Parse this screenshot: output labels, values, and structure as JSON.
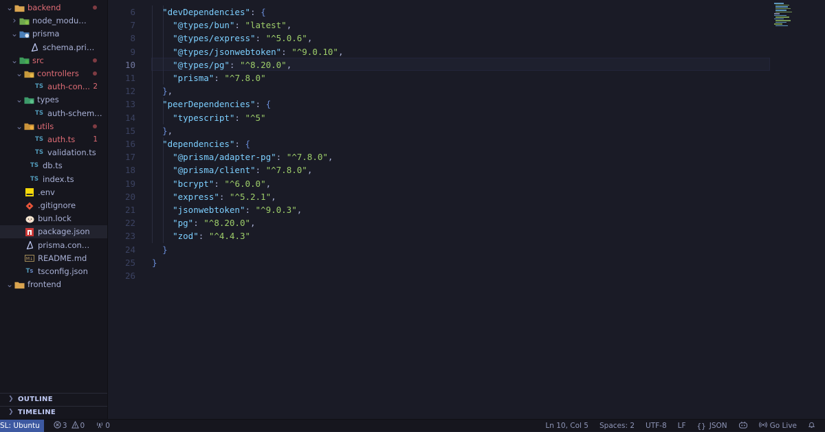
{
  "explorer": {
    "items": [
      {
        "label": "backend",
        "type": "folder",
        "open": true,
        "error": true,
        "dot": true
      },
      {
        "label": "node_modules",
        "type": "folder-node",
        "open": false
      },
      {
        "label": "prisma",
        "type": "folder-prisma",
        "open": true
      },
      {
        "label": "schema.prisma",
        "type": "file-prisma"
      },
      {
        "label": "src",
        "type": "folder-src",
        "open": true,
        "error": true,
        "dot": true
      },
      {
        "label": "controllers",
        "type": "folder-controllers",
        "open": true,
        "error": true,
        "dot": true
      },
      {
        "label": "auth-con...",
        "type": "file-ts",
        "error": true,
        "count": "2"
      },
      {
        "label": "types",
        "type": "folder-types",
        "open": true
      },
      {
        "label": "auth-schema.ts",
        "type": "file-ts"
      },
      {
        "label": "utils",
        "type": "folder-utils",
        "open": true,
        "error": true,
        "dot": true
      },
      {
        "label": "auth.ts",
        "type": "file-ts",
        "error": true,
        "count": "1"
      },
      {
        "label": "validation.ts",
        "type": "file-ts"
      },
      {
        "label": "db.ts",
        "type": "file-ts"
      },
      {
        "label": "index.ts",
        "type": "file-ts"
      },
      {
        "label": ".env",
        "type": "file-env"
      },
      {
        "label": ".gitignore",
        "type": "file-git"
      },
      {
        "label": "bun.lock",
        "type": "file-bun"
      },
      {
        "label": "package.json",
        "type": "file-npm",
        "selected": true
      },
      {
        "label": "prisma.config.ts",
        "type": "file-prisma"
      },
      {
        "label": "README.md",
        "type": "file-md"
      },
      {
        "label": "tsconfig.json",
        "type": "file-tsconfig"
      },
      {
        "label": "frontend",
        "type": "folder-root",
        "open": true
      }
    ],
    "outline_label": "OUTLINE",
    "timeline_label": "TIMELINE"
  },
  "editor": {
    "active_line": 10,
    "lines": [
      {
        "n": "6",
        "tokens": [
          [
            "p",
            "  "
          ],
          [
            "k",
            "\"devDependencies\""
          ],
          [
            "p",
            ": "
          ],
          [
            "b",
            "{"
          ]
        ]
      },
      {
        "n": "7",
        "tokens": [
          [
            "p",
            "    "
          ],
          [
            "k",
            "\"@types/bun\""
          ],
          [
            "p",
            ": "
          ],
          [
            "s",
            "\"latest\""
          ],
          [
            "p",
            ","
          ]
        ]
      },
      {
        "n": "8",
        "tokens": [
          [
            "p",
            "    "
          ],
          [
            "k",
            "\"@types/express\""
          ],
          [
            "p",
            ": "
          ],
          [
            "s",
            "\"^5.0.6\""
          ],
          [
            "p",
            ","
          ]
        ]
      },
      {
        "n": "9",
        "tokens": [
          [
            "p",
            "    "
          ],
          [
            "k",
            "\"@types/jsonwebtoken\""
          ],
          [
            "p",
            ": "
          ],
          [
            "s",
            "\"^9.0.10\""
          ],
          [
            "p",
            ","
          ]
        ]
      },
      {
        "n": "10",
        "tokens": [
          [
            "p",
            "    "
          ],
          [
            "k",
            "\"@types/pg\""
          ],
          [
            "p",
            ": "
          ],
          [
            "s",
            "\"^8.20.0\""
          ],
          [
            "p",
            ","
          ]
        ]
      },
      {
        "n": "11",
        "tokens": [
          [
            "p",
            "    "
          ],
          [
            "k",
            "\"prisma\""
          ],
          [
            "p",
            ": "
          ],
          [
            "s",
            "\"^7.8.0\""
          ]
        ]
      },
      {
        "n": "12",
        "tokens": [
          [
            "p",
            "  "
          ],
          [
            "b",
            "}"
          ],
          [
            "p",
            ","
          ]
        ]
      },
      {
        "n": "13",
        "tokens": [
          [
            "p",
            "  "
          ],
          [
            "k",
            "\"peerDependencies\""
          ],
          [
            "p",
            ": "
          ],
          [
            "b",
            "{"
          ]
        ]
      },
      {
        "n": "14",
        "tokens": [
          [
            "p",
            "    "
          ],
          [
            "k",
            "\"typescript\""
          ],
          [
            "p",
            ": "
          ],
          [
            "s",
            "\"^5\""
          ]
        ]
      },
      {
        "n": "15",
        "tokens": [
          [
            "p",
            "  "
          ],
          [
            "b",
            "}"
          ],
          [
            "p",
            ","
          ]
        ]
      },
      {
        "n": "16",
        "tokens": [
          [
            "p",
            "  "
          ],
          [
            "k",
            "\"dependencies\""
          ],
          [
            "p",
            ": "
          ],
          [
            "b",
            "{"
          ]
        ]
      },
      {
        "n": "17",
        "tokens": [
          [
            "p",
            "    "
          ],
          [
            "k",
            "\"@prisma/adapter-pg\""
          ],
          [
            "p",
            ": "
          ],
          [
            "s",
            "\"^7.8.0\""
          ],
          [
            "p",
            ","
          ]
        ]
      },
      {
        "n": "18",
        "tokens": [
          [
            "p",
            "    "
          ],
          [
            "k",
            "\"@prisma/client\""
          ],
          [
            "p",
            ": "
          ],
          [
            "s",
            "\"^7.8.0\""
          ],
          [
            "p",
            ","
          ]
        ]
      },
      {
        "n": "19",
        "tokens": [
          [
            "p",
            "    "
          ],
          [
            "k",
            "\"bcrypt\""
          ],
          [
            "p",
            ": "
          ],
          [
            "s",
            "\"^6.0.0\""
          ],
          [
            "p",
            ","
          ]
        ]
      },
      {
        "n": "20",
        "tokens": [
          [
            "p",
            "    "
          ],
          [
            "k",
            "\"express\""
          ],
          [
            "p",
            ": "
          ],
          [
            "s",
            "\"^5.2.1\""
          ],
          [
            "p",
            ","
          ]
        ]
      },
      {
        "n": "21",
        "tokens": [
          [
            "p",
            "    "
          ],
          [
            "k",
            "\"jsonwebtoken\""
          ],
          [
            "p",
            ": "
          ],
          [
            "s",
            "\"^9.0.3\""
          ],
          [
            "p",
            ","
          ]
        ]
      },
      {
        "n": "22",
        "tokens": [
          [
            "p",
            "    "
          ],
          [
            "k",
            "\"pg\""
          ],
          [
            "p",
            ": "
          ],
          [
            "s",
            "\"^8.20.0\""
          ],
          [
            "p",
            ","
          ]
        ]
      },
      {
        "n": "23",
        "tokens": [
          [
            "p",
            "    "
          ],
          [
            "k",
            "\"zod\""
          ],
          [
            "p",
            ": "
          ],
          [
            "s",
            "\"^4.4.3\""
          ]
        ]
      },
      {
        "n": "24",
        "tokens": [
          [
            "p",
            "  "
          ],
          [
            "b",
            "}"
          ]
        ]
      },
      {
        "n": "25",
        "tokens": [
          [
            "b",
            "}"
          ]
        ]
      },
      {
        "n": "26",
        "tokens": []
      }
    ]
  },
  "statusbar": {
    "remote": "SL: Ubuntu",
    "errors": "3",
    "warnings": "0",
    "ports": "0",
    "position": "Ln 10, Col 5",
    "spaces": "Spaces: 2",
    "encoding": "UTF-8",
    "eol": "LF",
    "language": "JSON",
    "golive": "Go Live"
  },
  "colors": {
    "background": "#1a1b26",
    "sidebar": "#16161e",
    "key": "#7dcfff",
    "string": "#9ece6a",
    "error": "#e06c75",
    "remote": "#3d59a1"
  }
}
